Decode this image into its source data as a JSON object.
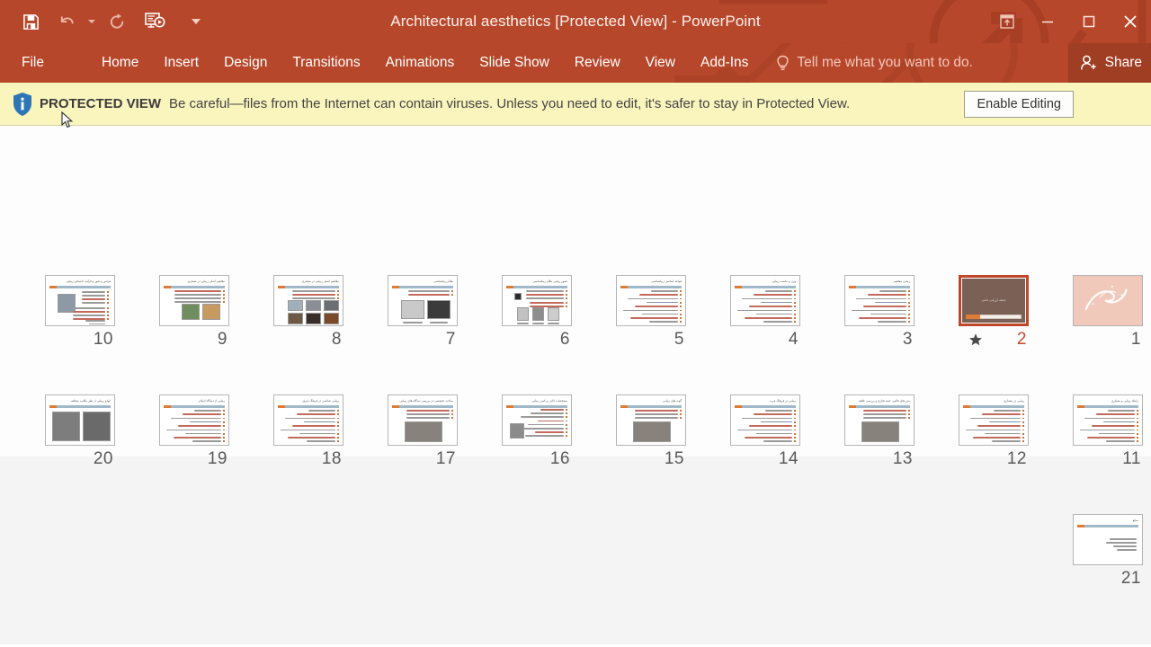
{
  "window": {
    "title": "Architectural aesthetics [Protected View] - PowerPoint",
    "accent_color": "#b7472a",
    "quick_access": [
      {
        "name": "save-icon",
        "label": "Save"
      },
      {
        "name": "undo-icon",
        "label": "Undo"
      },
      {
        "name": "redo-icon",
        "label": "Repeat"
      },
      {
        "name": "start-slideshow-icon",
        "label": "Start From Beginning"
      },
      {
        "name": "customize-quick-access-toolbar-icon",
        "label": "Customize Quick Access Toolbar"
      }
    ],
    "controls": [
      {
        "name": "ribbon-display-options-icon",
        "label": "Ribbon Display Options"
      },
      {
        "name": "minimize-icon",
        "label": "Minimize"
      },
      {
        "name": "restore-icon",
        "label": "Restore Down"
      },
      {
        "name": "close-icon",
        "label": "Close"
      }
    ]
  },
  "ribbon": {
    "tabs": [
      {
        "label": "File"
      },
      {
        "label": "Home"
      },
      {
        "label": "Insert"
      },
      {
        "label": "Design"
      },
      {
        "label": "Transitions"
      },
      {
        "label": "Animations"
      },
      {
        "label": "Slide Show"
      },
      {
        "label": "Review"
      },
      {
        "label": "View"
      },
      {
        "label": "Add-Ins"
      }
    ],
    "tell_me": "Tell me what you want to do.",
    "share": "Share"
  },
  "protected_view": {
    "icon": "info-shield-icon",
    "title": "PROTECTED VIEW",
    "message": "Be careful—files from the Internet can contain viruses. Unless you need to edit, it's safer to stay in Protected View.",
    "enable_button": "Enable Editing",
    "background_color": "#faf4bd"
  },
  "slide_sorter": {
    "selected_slide": 2,
    "slides": [
      {
        "number": "10",
        "kind": "text-image-left",
        "title": "هراس و شور و فرآیند احساس زیبایی"
      },
      {
        "number": "9",
        "kind": "text-two-images",
        "title": "مفاهیم اصلی زیبایی در معماری"
      },
      {
        "number": "8",
        "kind": "image-grid",
        "title": "مفاهیم اصلی زیبایی در معماری"
      },
      {
        "number": "7",
        "kind": "two-images",
        "title": "نظام زیباشناسی"
      },
      {
        "number": "6",
        "kind": "three-images",
        "title": "تصور زیبایی نظام زیباشناسی"
      },
      {
        "number": "5",
        "kind": "text-only",
        "title": "قواعد اساسی زیباشناسی"
      },
      {
        "number": "4",
        "kind": "text-only",
        "title": "وزن و تناسب زیبایی"
      },
      {
        "number": "3",
        "kind": "text-only",
        "title": "زیبایی مفاهیم"
      },
      {
        "number": "2",
        "kind": "dark-title",
        "title": "جمعه ارزیابی ناشی",
        "has_animation": true
      },
      {
        "number": "1",
        "kind": "cover",
        "title": ""
      },
      {
        "number": "20",
        "kind": "two-dark-images",
        "title": "انواع زیبایی از نظر مکاتب مختلف"
      },
      {
        "number": "19",
        "kind": "text-only",
        "title": "زیبایی از دیدگاه اسلام"
      },
      {
        "number": "18",
        "kind": "text-only",
        "title": "زیبایی شناسی در فرهنگ شرق"
      },
      {
        "number": "17",
        "kind": "wide-image",
        "title": "مباحث تخصصی در بررسی دیدگاه های زیبایی"
      },
      {
        "number": "16",
        "kind": "image-left-text",
        "title": "مشخصات اثاثی و کمی زیبایی"
      },
      {
        "number": "15",
        "kind": "wide-image",
        "title": "گونه های زیبایی"
      },
      {
        "number": "14",
        "kind": "text-only",
        "title": "زیبایی در فرهنگ غرب"
      },
      {
        "number": "13",
        "kind": "wide-image",
        "title": "متن های قالبی، جنبه تجاری و بررسی علاقه"
      },
      {
        "number": "12",
        "kind": "text-only",
        "title": "زیبایی در معماری"
      },
      {
        "number": "11",
        "kind": "text-only",
        "title": "رابطه زیبایی و معماری"
      },
      {
        "number": "21",
        "kind": "closing",
        "title": "منابع"
      }
    ]
  }
}
